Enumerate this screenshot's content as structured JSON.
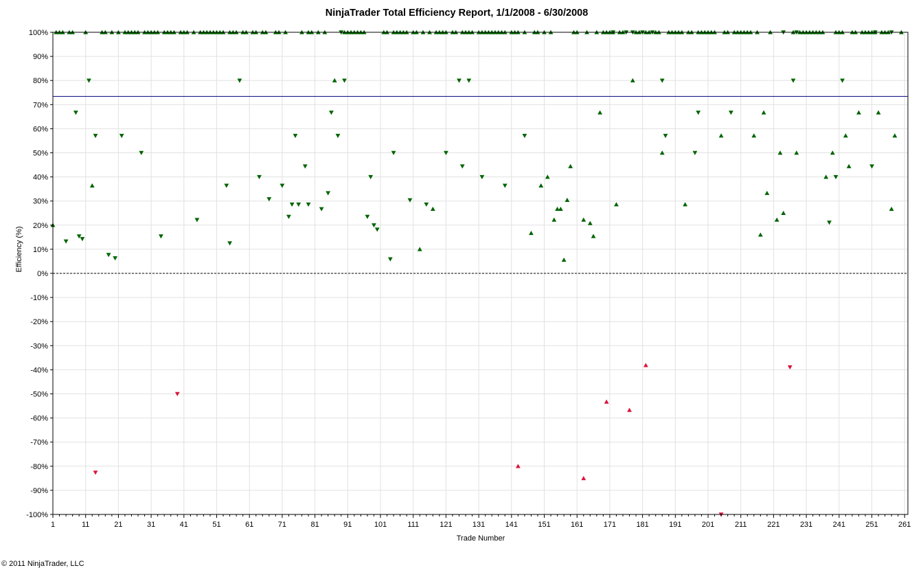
{
  "chart_data": {
    "type": "scatter",
    "title": "NinjaTrader Total Efficiency Report, 1/1/2008 - 6/30/2008",
    "xlabel": "Trade Number",
    "ylabel": "Efficiency (%)",
    "xlim": [
      1,
      262
    ],
    "ylim": [
      -100,
      100
    ],
    "x_ticks": [
      1,
      11,
      21,
      31,
      41,
      51,
      61,
      71,
      81,
      91,
      101,
      111,
      121,
      131,
      141,
      151,
      161,
      171,
      181,
      191,
      201,
      211,
      221,
      231,
      241,
      251,
      261
    ],
    "y_ticks": [
      100,
      90,
      80,
      70,
      60,
      50,
      40,
      30,
      20,
      10,
      0,
      -10,
      -20,
      -30,
      -40,
      -50,
      -60,
      -70,
      -80,
      -90,
      -100
    ],
    "y_tick_labels": [
      "100%",
      "90%",
      "80%",
      "70%",
      "60%",
      "50%",
      "40%",
      "30%",
      "20%",
      "10%",
      "0%",
      "-10%",
      "-20%",
      "-30%",
      "-40%",
      "-50%",
      "-60%",
      "-70%",
      "-80%",
      "-90%",
      "-100%"
    ],
    "grid": true,
    "average_line": {
      "value": 73.4,
      "color": "#000080"
    },
    "zero_line": {
      "value": 0,
      "style": "dashed",
      "color": "#000000"
    },
    "colors": {
      "positive": "#006400",
      "negative": "#dc143c",
      "grid": "#e1e1e1",
      "border": "#000000"
    },
    "series": [
      {
        "marker": "triangle-up",
        "color": "#006400",
        "points": [
          [
            1,
            20
          ],
          [
            2,
            100
          ],
          [
            3,
            100
          ],
          [
            4,
            100
          ],
          [
            6,
            100
          ],
          [
            7,
            100
          ],
          [
            11,
            100
          ],
          [
            13,
            36.4
          ],
          [
            16,
            100
          ],
          [
            17,
            100
          ],
          [
            19,
            100
          ],
          [
            21,
            100
          ],
          [
            23,
            100
          ],
          [
            24,
            100
          ],
          [
            25,
            100
          ],
          [
            26,
            100
          ],
          [
            27,
            100
          ],
          [
            29,
            100
          ],
          [
            30,
            100
          ],
          [
            31,
            100
          ],
          [
            32,
            100
          ],
          [
            33,
            100
          ],
          [
            35,
            100
          ],
          [
            36,
            100
          ],
          [
            37,
            100
          ],
          [
            38,
            100
          ],
          [
            40,
            100
          ],
          [
            41,
            100
          ],
          [
            42,
            100
          ],
          [
            44,
            100
          ],
          [
            46,
            100
          ],
          [
            47,
            100
          ],
          [
            48,
            100
          ],
          [
            49,
            100
          ],
          [
            50,
            100
          ],
          [
            51,
            100
          ],
          [
            52,
            100
          ],
          [
            53,
            100
          ],
          [
            55,
            100
          ],
          [
            56,
            100
          ],
          [
            57,
            100
          ],
          [
            59,
            100
          ],
          [
            60,
            100
          ],
          [
            62,
            100
          ],
          [
            63,
            100
          ],
          [
            65,
            100
          ],
          [
            66,
            100
          ],
          [
            69,
            100
          ],
          [
            70,
            100
          ],
          [
            72,
            100
          ],
          [
            77,
            100
          ],
          [
            79,
            100
          ],
          [
            80,
            100
          ],
          [
            82,
            100
          ],
          [
            84,
            100
          ],
          [
            87,
            80
          ],
          [
            90,
            100
          ],
          [
            91,
            100
          ],
          [
            92,
            100
          ],
          [
            93,
            100
          ],
          [
            94,
            100
          ],
          [
            95,
            100
          ],
          [
            96,
            100
          ],
          [
            102,
            100
          ],
          [
            103,
            100
          ],
          [
            105,
            100
          ],
          [
            106,
            100
          ],
          [
            107,
            100
          ],
          [
            108,
            100
          ],
          [
            109,
            100
          ],
          [
            111,
            100
          ],
          [
            112,
            100
          ],
          [
            113,
            10
          ],
          [
            114,
            100
          ],
          [
            116,
            100
          ],
          [
            117,
            26.7
          ],
          [
            118,
            100
          ],
          [
            119,
            100
          ],
          [
            120,
            100
          ],
          [
            121,
            100
          ],
          [
            123,
            100
          ],
          [
            124,
            100
          ],
          [
            126,
            100
          ],
          [
            127,
            100
          ],
          [
            128,
            100
          ],
          [
            129,
            100
          ],
          [
            131,
            100
          ],
          [
            132,
            100
          ],
          [
            133,
            100
          ],
          [
            134,
            100
          ],
          [
            135,
            100
          ],
          [
            136,
            100
          ],
          [
            137,
            100
          ],
          [
            138,
            100
          ],
          [
            139,
            100
          ],
          [
            141,
            100
          ],
          [
            142,
            100
          ],
          [
            143,
            100
          ],
          [
            145,
            100
          ],
          [
            147,
            16.7
          ],
          [
            148,
            100
          ],
          [
            149,
            100
          ],
          [
            150,
            36.4
          ],
          [
            151,
            100
          ],
          [
            152,
            40
          ],
          [
            153,
            100
          ],
          [
            154,
            22.2
          ],
          [
            155,
            26.7
          ],
          [
            156,
            26.7
          ],
          [
            157,
            5.6
          ],
          [
            158,
            30.4
          ],
          [
            159,
            44.4
          ],
          [
            160,
            100
          ],
          [
            161,
            100
          ],
          [
            163,
            22.2
          ],
          [
            164,
            100
          ],
          [
            165,
            20.8
          ],
          [
            166,
            15.4
          ],
          [
            167,
            100
          ],
          [
            168,
            66.7
          ],
          [
            169,
            100
          ],
          [
            170,
            100
          ],
          [
            171,
            100
          ],
          [
            172,
            100
          ],
          [
            173,
            28.6
          ],
          [
            174,
            100
          ],
          [
            175,
            100
          ],
          [
            178,
            80
          ],
          [
            179,
            100
          ],
          [
            180,
            100
          ],
          [
            182,
            100
          ],
          [
            183,
            100
          ],
          [
            185,
            100
          ],
          [
            186,
            100
          ],
          [
            187,
            50
          ],
          [
            189,
            100
          ],
          [
            190,
            100
          ],
          [
            191,
            100
          ],
          [
            192,
            100
          ],
          [
            193,
            100
          ],
          [
            194,
            28.6
          ],
          [
            195,
            100
          ],
          [
            196,
            100
          ],
          [
            198,
            100
          ],
          [
            199,
            100
          ],
          [
            200,
            100
          ],
          [
            201,
            100
          ],
          [
            202,
            100
          ],
          [
            203,
            100
          ],
          [
            205,
            57.1
          ],
          [
            206,
            100
          ],
          [
            207,
            100
          ],
          [
            209,
            100
          ],
          [
            210,
            100
          ],
          [
            211,
            100
          ],
          [
            212,
            100
          ],
          [
            213,
            100
          ],
          [
            214,
            100
          ],
          [
            215,
            57.1
          ],
          [
            216,
            100
          ],
          [
            217,
            16
          ],
          [
            218,
            66.7
          ],
          [
            219,
            33.3
          ],
          [
            220,
            100
          ],
          [
            222,
            22.2
          ],
          [
            223,
            50
          ],
          [
            224,
            25
          ],
          [
            227,
            100
          ],
          [
            228,
            50
          ],
          [
            229,
            100
          ],
          [
            230,
            100
          ],
          [
            231,
            100
          ],
          [
            232,
            100
          ],
          [
            233,
            100
          ],
          [
            234,
            100
          ],
          [
            235,
            100
          ],
          [
            236,
            100
          ],
          [
            237,
            40
          ],
          [
            239,
            50
          ],
          [
            240,
            100
          ],
          [
            241,
            100
          ],
          [
            242,
            100
          ],
          [
            243,
            57.1
          ],
          [
            244,
            44.4
          ],
          [
            245,
            100
          ],
          [
            246,
            100
          ],
          [
            247,
            66.7
          ],
          [
            248,
            100
          ],
          [
            249,
            100
          ],
          [
            250,
            100
          ],
          [
            251,
            100
          ],
          [
            252,
            100
          ],
          [
            253,
            66.7
          ],
          [
            254,
            100
          ],
          [
            255,
            100
          ],
          [
            256,
            100
          ],
          [
            257,
            26.7
          ],
          [
            258,
            57.1
          ],
          [
            260,
            100
          ]
        ]
      },
      {
        "marker": "triangle-down",
        "color": "#006400",
        "points": [
          [
            5,
            13.3
          ],
          [
            8,
            66.7
          ],
          [
            9,
            15.4
          ],
          [
            10,
            14.3
          ],
          [
            12,
            80
          ],
          [
            14,
            57.1
          ],
          [
            18,
            7.7
          ],
          [
            20,
            6.3
          ],
          [
            22,
            57.1
          ],
          [
            28,
            50
          ],
          [
            34,
            15.4
          ],
          [
            45,
            22.2
          ],
          [
            54,
            36.4
          ],
          [
            55,
            12.5
          ],
          [
            58,
            80
          ],
          [
            64,
            40
          ],
          [
            67,
            30.8
          ],
          [
            71,
            36.4
          ],
          [
            73,
            23.5
          ],
          [
            74,
            28.6
          ],
          [
            75,
            57.1
          ],
          [
            76,
            28.6
          ],
          [
            78,
            44.4
          ],
          [
            79,
            28.6
          ],
          [
            83,
            26.7
          ],
          [
            85,
            33.3
          ],
          [
            86,
            66.7
          ],
          [
            88,
            57.1
          ],
          [
            89,
            100
          ],
          [
            90,
            80
          ],
          [
            97,
            23.5
          ],
          [
            98,
            40
          ],
          [
            99,
            20
          ],
          [
            100,
            18.2
          ],
          [
            104,
            5.9
          ],
          [
            105,
            50
          ],
          [
            110,
            30.4
          ],
          [
            115,
            28.6
          ],
          [
            121,
            50
          ],
          [
            125,
            80
          ],
          [
            126,
            44.4
          ],
          [
            128,
            80
          ],
          [
            132,
            40
          ],
          [
            139,
            36.4
          ],
          [
            145,
            57.1
          ],
          [
            172,
            100
          ],
          [
            176,
            100
          ],
          [
            178,
            100
          ],
          [
            181,
            100
          ],
          [
            184,
            100
          ],
          [
            187,
            80
          ],
          [
            188,
            57.1
          ],
          [
            197,
            50
          ],
          [
            198,
            66.7
          ],
          [
            208,
            66.7
          ],
          [
            224,
            100
          ],
          [
            227,
            80
          ],
          [
            228,
            100
          ],
          [
            238,
            21.1
          ],
          [
            240,
            40
          ],
          [
            242,
            80
          ],
          [
            251,
            44.4
          ],
          [
            252,
            100
          ],
          [
            257,
            100
          ]
        ]
      },
      {
        "marker": "triangle-up",
        "color": "#dc143c",
        "points": [
          [
            143,
            -80
          ],
          [
            163,
            -85
          ],
          [
            170,
            -53.3
          ],
          [
            177,
            -56.7
          ],
          [
            182,
            -38.1
          ]
        ]
      },
      {
        "marker": "triangle-down",
        "color": "#dc143c",
        "points": [
          [
            14,
            -82.6
          ],
          [
            39,
            -50
          ],
          [
            205,
            -100
          ],
          [
            226,
            -38.9
          ]
        ]
      }
    ],
    "copyright": "© 2011 NinjaTrader, LLC"
  }
}
